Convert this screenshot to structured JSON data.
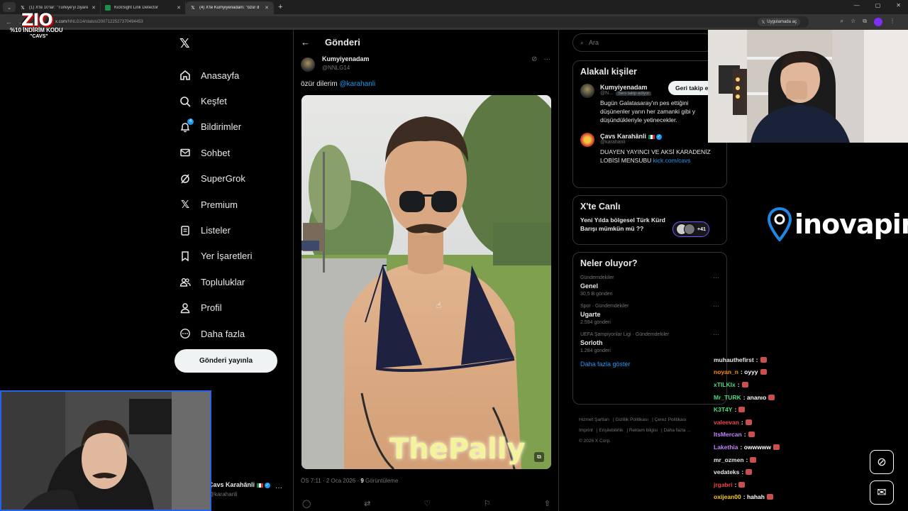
{
  "browser": {
    "tabs": [
      {
        "label": "(1) X'te 10'lar: \"Türkiye'yi ziyaret",
        "favicon": "x-icon",
        "active": false
      },
      {
        "label": "KickSight Link Detector",
        "favicon": "kicksight-icon",
        "active": false
      },
      {
        "label": "(4) X'te Kumyiyenadam: \"özür d",
        "favicon": "x-icon",
        "active": true
      }
    ],
    "url_host": "x.com",
    "url_path": "/NNLG14/status/2007122527370494453",
    "open_in_app": "Uygulamada aç"
  },
  "promo": {
    "brand": "ZIO",
    "code_line": "%10 İNDİRİM KODU",
    "code": "\"CAVS\""
  },
  "sidebar": {
    "items": [
      {
        "label": "Anasayfa",
        "icon": "home-icon"
      },
      {
        "label": "Keşfet",
        "icon": "search-icon"
      },
      {
        "label": "Bildirimler",
        "icon": "bell-icon",
        "badge": "4"
      },
      {
        "label": "Sohbet",
        "icon": "mail-icon"
      },
      {
        "label": "SuperGrok",
        "icon": "grok-icon"
      },
      {
        "label": "Premium",
        "icon": "x-icon"
      },
      {
        "label": "Listeler",
        "icon": "list-icon"
      },
      {
        "label": "Yer İşaretleri",
        "icon": "bookmark-icon"
      },
      {
        "label": "Topluluklar",
        "icon": "people-icon"
      },
      {
        "label": "Profil",
        "icon": "profile-icon"
      },
      {
        "label": "Daha fazla",
        "icon": "more-icon"
      }
    ],
    "post_button": "Gönderi yayınla",
    "account_name": "Çavs Karahânli",
    "account_handle": "@karahanli"
  },
  "post": {
    "header": "Gönderi",
    "author_name": "Kumyiyenadam",
    "author_handle": "@NNLG14",
    "text_prefix": "özür dilerim ",
    "mention": "@karahanli",
    "media_watermark": "ThePally",
    "time": "ÖS 7:11 · 2 Oca 2026 · ",
    "views_count": "9",
    "views_label": " Görüntüleme"
  },
  "right": {
    "search_placeholder": "Ara",
    "related_title": "Alakalı kişiler",
    "people": [
      {
        "name": "Kumyiyenadam",
        "handle": "@N...",
        "follows_you": "Seni takip ediyor",
        "button": "Geri takip e",
        "bio": "Bugün Galatasaray'ın pes ettiğini düşünenler yarın her zamanki gibi y düşündükleriyle yetinecekler."
      },
      {
        "name": "Çavs Karahânli",
        "handle": "@karahanli",
        "bio": "DUAYEN YAYINCI VE AKSİ KARADENİZ LOBİSİ MENSUBU ",
        "bio_link": "kick.com/cavs"
      }
    ],
    "live_title": "X'te Canlı",
    "live_text": "Yeni Yılda bölgesel Türk Kürd Barışı mümkün mü ??",
    "live_count": "+41",
    "trends_title": "Neler oluyor?",
    "trends": [
      {
        "category": "Gündemdekiler",
        "title": "Genel",
        "count": "30,5 B gönderi"
      },
      {
        "category": "Spor · Gündemdekiler",
        "title": "Ugarte",
        "count": "2.594 gönderi"
      },
      {
        "category": "UEFA Şampiyonlar Ligi · Gündemdekiler",
        "title": "Sorloth",
        "count": "1.284 gönderi"
      }
    ],
    "show_more": "Daha fazla göster",
    "footer_links": [
      "Hizmet Şartları",
      "Gizlilik Politikası",
      "Çerez Politikası",
      "Imprint",
      "Erişilebilirlik",
      "Reklam bilgisi",
      "Daha fazla ...",
      "© 2026 X Corp."
    ]
  },
  "sponsor": {
    "text": "inovapin"
  },
  "chat": [
    {
      "user": "muhauthefirst",
      "msg": ":",
      "color": "#e7e9ea"
    },
    {
      "user": "noyan_n",
      "msg": ": oyyy",
      "color": "#ff8c00"
    },
    {
      "user": "xTILKIx",
      "msg": ":",
      "color": "#4ade80"
    },
    {
      "user": "Mr_TURK",
      "msg": ": ananıo",
      "color": "#4ade80"
    },
    {
      "user": "K3T4Y",
      "msg": ":",
      "color": "#4ade80"
    },
    {
      "user": "valeevan",
      "msg": ":",
      "color": "#ef4444"
    },
    {
      "user": "ItsMercan",
      "msg": ":",
      "color": "#c084fc"
    },
    {
      "user": "Lakethia",
      "msg": ": owwwww",
      "color": "#c084fc"
    },
    {
      "user": "mr_ozmen",
      "msg": ":",
      "color": "#e7e9ea"
    },
    {
      "user": "vedateks",
      "msg": ":",
      "color": "#e7e9ea"
    },
    {
      "user": "jrgabri",
      "msg": ":",
      "color": "#ef4444"
    },
    {
      "user": "oxijean00",
      "msg": ": hahah",
      "color": "#facc15"
    }
  ],
  "colors": {
    "accent": "#1d9bf0",
    "border": "#2f3336",
    "muted": "#71767b"
  }
}
